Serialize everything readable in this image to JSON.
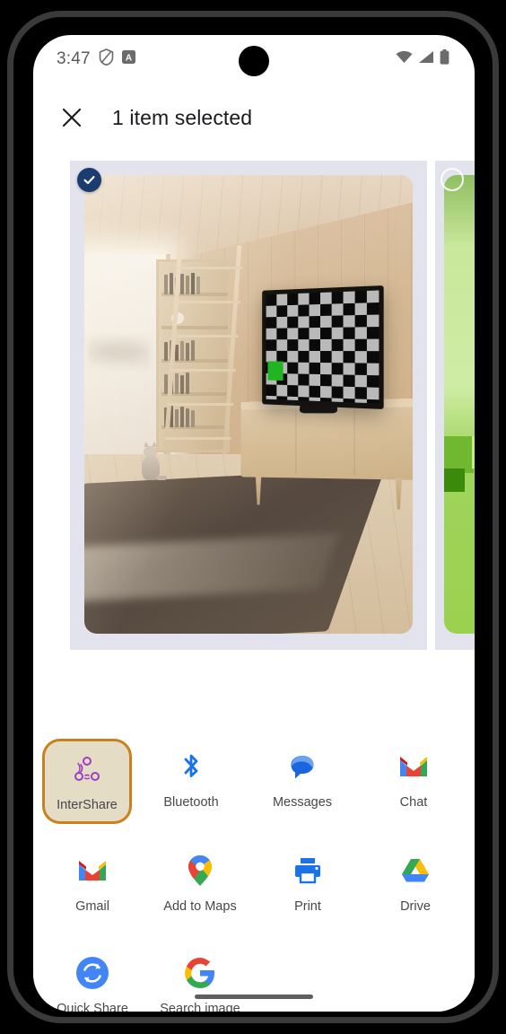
{
  "status_bar": {
    "clock": "3:47",
    "icons": [
      "shield-icon",
      "a-badge-icon",
      "wifi-icon",
      "signal-icon",
      "battery-icon"
    ]
  },
  "app_bar": {
    "close_icon": "close-icon",
    "title": "1 item selected"
  },
  "preview": {
    "items": [
      {
        "name": "living-room-photo",
        "selected": true,
        "badge": "check-icon",
        "description": "Wood-panelled living room with bookshelf ladder, window, cat, TV showing checkerboard test pattern with green square, console and rug"
      },
      {
        "name": "green-photo",
        "selected": false,
        "badge": "empty-circle-icon",
        "description": "Green gradient image partially visible at right edge"
      }
    ]
  },
  "share_sheet": {
    "rows": [
      [
        {
          "label": "InterShare",
          "icon": "intershare-icon",
          "selected": true
        },
        {
          "label": "Bluetooth",
          "icon": "bluetooth-icon",
          "selected": false
        },
        {
          "label": "Messages",
          "icon": "messages-icon",
          "selected": false
        },
        {
          "label": "Chat",
          "icon": "chat-icon",
          "selected": false
        }
      ],
      [
        {
          "label": "Gmail",
          "icon": "gmail-icon",
          "selected": false
        },
        {
          "label": "Add to Maps",
          "icon": "maps-icon",
          "selected": false
        },
        {
          "label": "Print",
          "icon": "print-icon",
          "selected": false
        },
        {
          "label": "Drive",
          "icon": "drive-icon",
          "selected": false
        }
      ],
      [
        {
          "label": "Quick Share",
          "icon": "quick-share-icon",
          "selected": false
        },
        {
          "label": "Search image",
          "icon": "google-icon",
          "selected": false
        }
      ]
    ]
  },
  "nav": {
    "home_indicator": "home-indicator"
  },
  "colors": {
    "accent_selected": "#c8811e",
    "selected_bg": "#e4dcc4",
    "check_badge": "#1b3c6e",
    "preview_bg": "#e3e3ed",
    "text_primary": "#1b1b1f",
    "text_secondary": "#45474a"
  }
}
